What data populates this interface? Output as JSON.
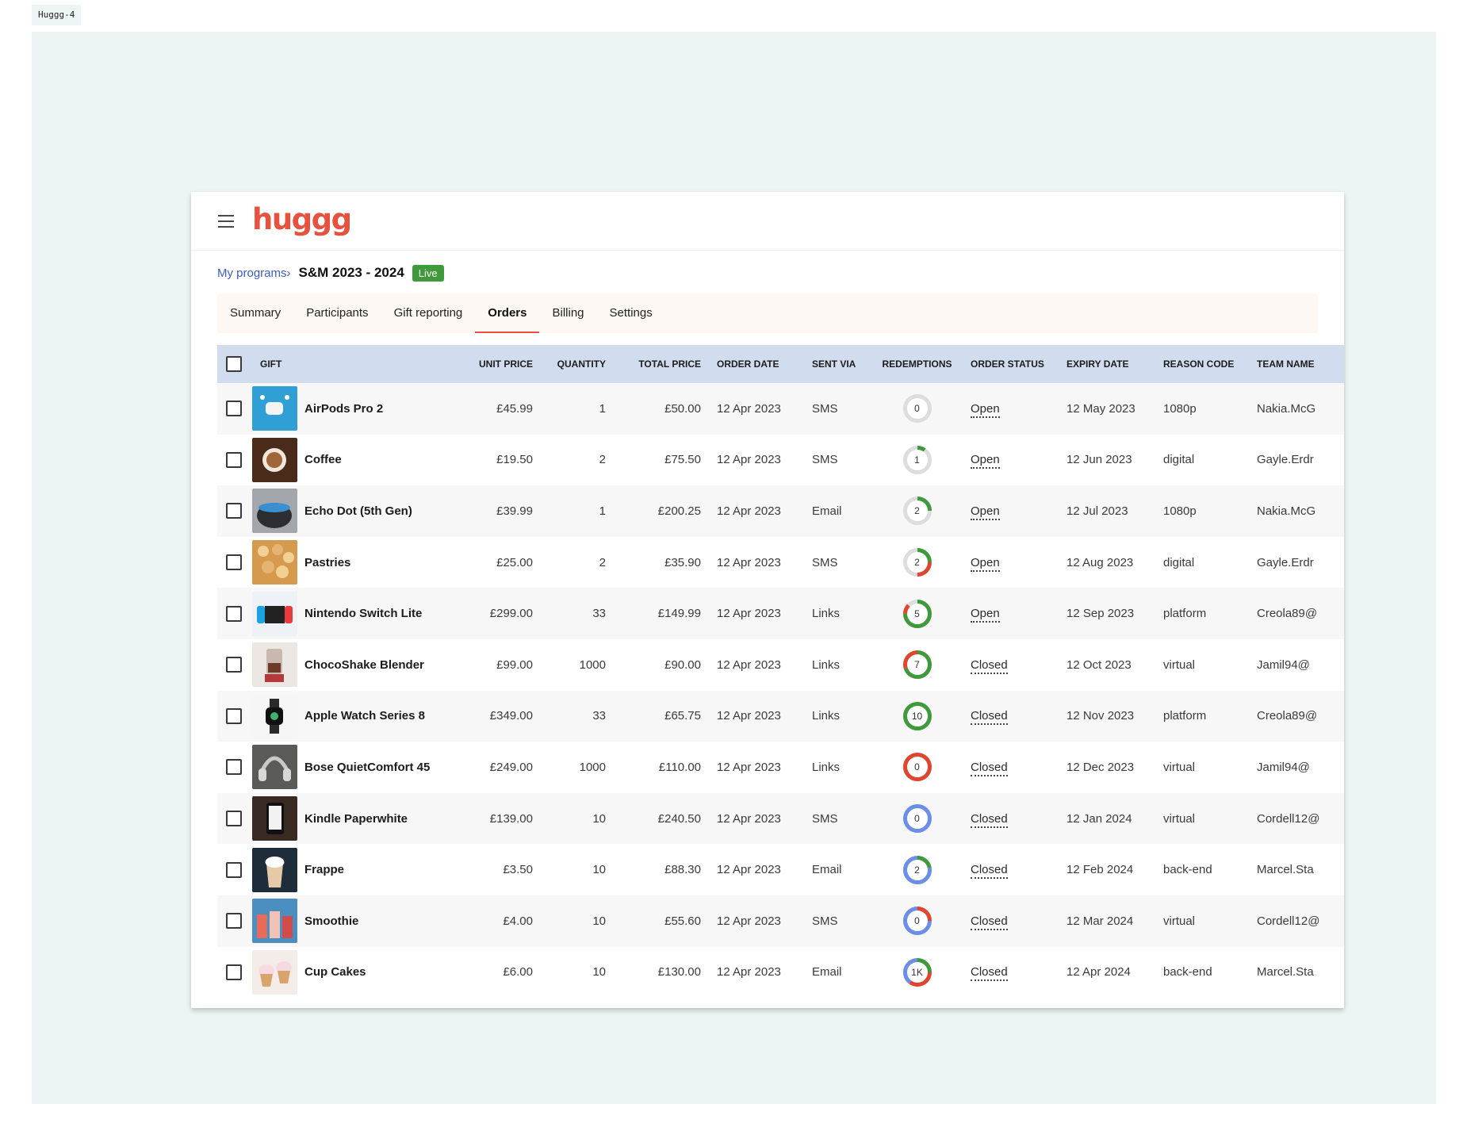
{
  "frame_label": "Huggg-4",
  "app": {
    "logo": "huggg"
  },
  "breadcrumb": {
    "parent": "My programs",
    "separator": "›",
    "title": "S&M 2023 - 2024",
    "status_badge": "Live"
  },
  "tabs": [
    {
      "label": "Summary",
      "active": false
    },
    {
      "label": "Participants",
      "active": false
    },
    {
      "label": "Gift reporting",
      "active": false
    },
    {
      "label": "Orders",
      "active": true
    },
    {
      "label": "Billing",
      "active": false
    },
    {
      "label": "Settings",
      "active": false
    }
  ],
  "table": {
    "columns": [
      "Gift",
      "Unit price",
      "Quantity",
      "Total price",
      "Order date",
      "Sent via",
      "Redemptions",
      "Order status",
      "Expiry date",
      "Reason code",
      "Team name"
    ],
    "rows": [
      {
        "gift": "AirPods Pro 2",
        "thumb_icon": "earbuds-image",
        "unit_price": "£45.99",
        "quantity": "1",
        "total_price": "£50.00",
        "order_date": "12 Apr 2023",
        "sent_via": "SMS",
        "redemptions": "0",
        "redemption_progress": {
          "green": 0,
          "red": 0,
          "blue": 0
        },
        "order_status": "Open",
        "expiry_date": "12 May 2023",
        "reason_code": "1080p",
        "team_name": "Nakia.McG"
      },
      {
        "gift": "Coffee",
        "thumb_icon": "coffee-cup-image",
        "unit_price": "£19.50",
        "quantity": "2",
        "total_price": "£75.50",
        "order_date": "12 Apr 2023",
        "sent_via": "SMS",
        "redemptions": "1",
        "redemption_progress": {
          "green": 0.1,
          "red": 0,
          "blue": 0
        },
        "order_status": "Open",
        "expiry_date": "12 Jun 2023",
        "reason_code": "digital",
        "team_name": "Gayle.Erdr"
      },
      {
        "gift": "Echo Dot (5th Gen)",
        "thumb_icon": "smart-speaker-image",
        "unit_price": "£39.99",
        "quantity": "1",
        "total_price": "£200.25",
        "order_date": "12 Apr 2023",
        "sent_via": "Email",
        "redemptions": "2",
        "redemption_progress": {
          "green": 0.25,
          "red": 0,
          "blue": 0
        },
        "order_status": "Open",
        "expiry_date": "12 Jul 2023",
        "reason_code": "1080p",
        "team_name": "Nakia.McG"
      },
      {
        "gift": "Pastries",
        "thumb_icon": "pastries-image",
        "unit_price": "£25.00",
        "quantity": "2",
        "total_price": "£35.90",
        "order_date": "12 Apr 2023",
        "sent_via": "SMS",
        "redemptions": "2",
        "redemption_progress": {
          "green": 0.25,
          "red": 0.25,
          "blue": 0
        },
        "order_status": "Open",
        "expiry_date": "12 Aug 2023",
        "reason_code": "digital",
        "team_name": "Gayle.Erdr"
      },
      {
        "gift": "Nintendo Switch Lite",
        "thumb_icon": "game-console-image",
        "unit_price": "£299.00",
        "quantity": "33",
        "total_price": "£149.99",
        "order_date": "12 Apr 2023",
        "sent_via": "Links",
        "redemptions": "5",
        "redemption_progress": {
          "green": 0.75,
          "red": 0.12,
          "blue": 0
        },
        "order_status": "Open",
        "expiry_date": "12 Sep 2023",
        "reason_code": "platform",
        "team_name": "Creola89@"
      },
      {
        "gift": "ChocoShake Blender",
        "thumb_icon": "blender-image",
        "unit_price": "£99.00",
        "quantity": "1000",
        "total_price": "£90.00",
        "order_date": "12 Apr 2023",
        "sent_via": "Links",
        "redemptions": "7",
        "redemption_progress": {
          "green": 0.7,
          "red": 0.3,
          "blue": 0
        },
        "order_status": "Closed",
        "expiry_date": "12 Oct 2023",
        "reason_code": "virtual",
        "team_name": "Jamil94@"
      },
      {
        "gift": "Apple Watch Series 8",
        "thumb_icon": "smartwatch-image",
        "unit_price": "£349.00",
        "quantity": "33",
        "total_price": "£65.75",
        "order_date": "12 Apr 2023",
        "sent_via": "Links",
        "redemptions": "10",
        "redemption_progress": {
          "green": 1,
          "red": 0,
          "blue": 0
        },
        "order_status": "Closed",
        "expiry_date": "12 Nov 2023",
        "reason_code": "platform",
        "team_name": "Creola89@"
      },
      {
        "gift": "Bose QuietComfort 45",
        "thumb_icon": "headphones-image",
        "unit_price": "£249.00",
        "quantity": "1000",
        "total_price": "£110.00",
        "order_date": "12 Apr 2023",
        "sent_via": "Links",
        "redemptions": "0",
        "redemption_progress": {
          "green": 0,
          "red": 1,
          "blue": 0
        },
        "order_status": "Closed",
        "expiry_date": "12 Dec 2023",
        "reason_code": "virtual",
        "team_name": "Jamil94@"
      },
      {
        "gift": "Kindle Paperwhite",
        "thumb_icon": "ereader-image",
        "unit_price": "£139.00",
        "quantity": "10",
        "total_price": "£240.50",
        "order_date": "12 Apr 2023",
        "sent_via": "SMS",
        "redemptions": "0",
        "redemption_progress": {
          "green": 0,
          "red": 0,
          "blue": 1
        },
        "order_status": "Closed",
        "expiry_date": "12 Jan 2024",
        "reason_code": "virtual",
        "team_name": "Cordell12@"
      },
      {
        "gift": "Frappe",
        "thumb_icon": "frappe-image",
        "unit_price": "£3.50",
        "quantity": "10",
        "total_price": "£88.30",
        "order_date": "12 Apr 2023",
        "sent_via": "Email",
        "redemptions": "2",
        "redemption_progress": {
          "green": 0.22,
          "red": 0,
          "blue": 0.78
        },
        "order_status": "Closed",
        "expiry_date": "12 Feb 2024",
        "reason_code": "back-end",
        "team_name": "Marcel.Sta"
      },
      {
        "gift": "Smoothie",
        "thumb_icon": "smoothie-image",
        "unit_price": "£4.00",
        "quantity": "10",
        "total_price": "£55.60",
        "order_date": "12 Apr 2023",
        "sent_via": "SMS",
        "redemptions": "0",
        "redemption_progress": {
          "green": 0,
          "red": 0.25,
          "blue": 0.75
        },
        "order_status": "Closed",
        "expiry_date": "12 Mar 2024",
        "reason_code": "virtual",
        "team_name": "Cordell12@"
      },
      {
        "gift": "Cup Cakes",
        "thumb_icon": "cupcakes-image",
        "unit_price": "£6.00",
        "quantity": "10",
        "total_price": "£130.00",
        "order_date": "12 Apr 2023",
        "sent_via": "Email",
        "redemptions": "1K",
        "redemption_progress": {
          "green": 0.25,
          "red": 0.35,
          "blue": 0.4
        },
        "order_status": "Closed",
        "expiry_date": "12 Apr 2024",
        "reason_code": "back-end",
        "team_name": "Marcel.Sta"
      }
    ]
  },
  "colors": {
    "brand": "#e7513d",
    "live_badge": "#3e9a3b",
    "header_row": "#d1dcef",
    "link": "#3c5acb",
    "redemption_green": "#3e9a3b",
    "redemption_red": "#e0452f",
    "redemption_blue": "#6b8fe8",
    "ring_track": "#dddddd"
  }
}
